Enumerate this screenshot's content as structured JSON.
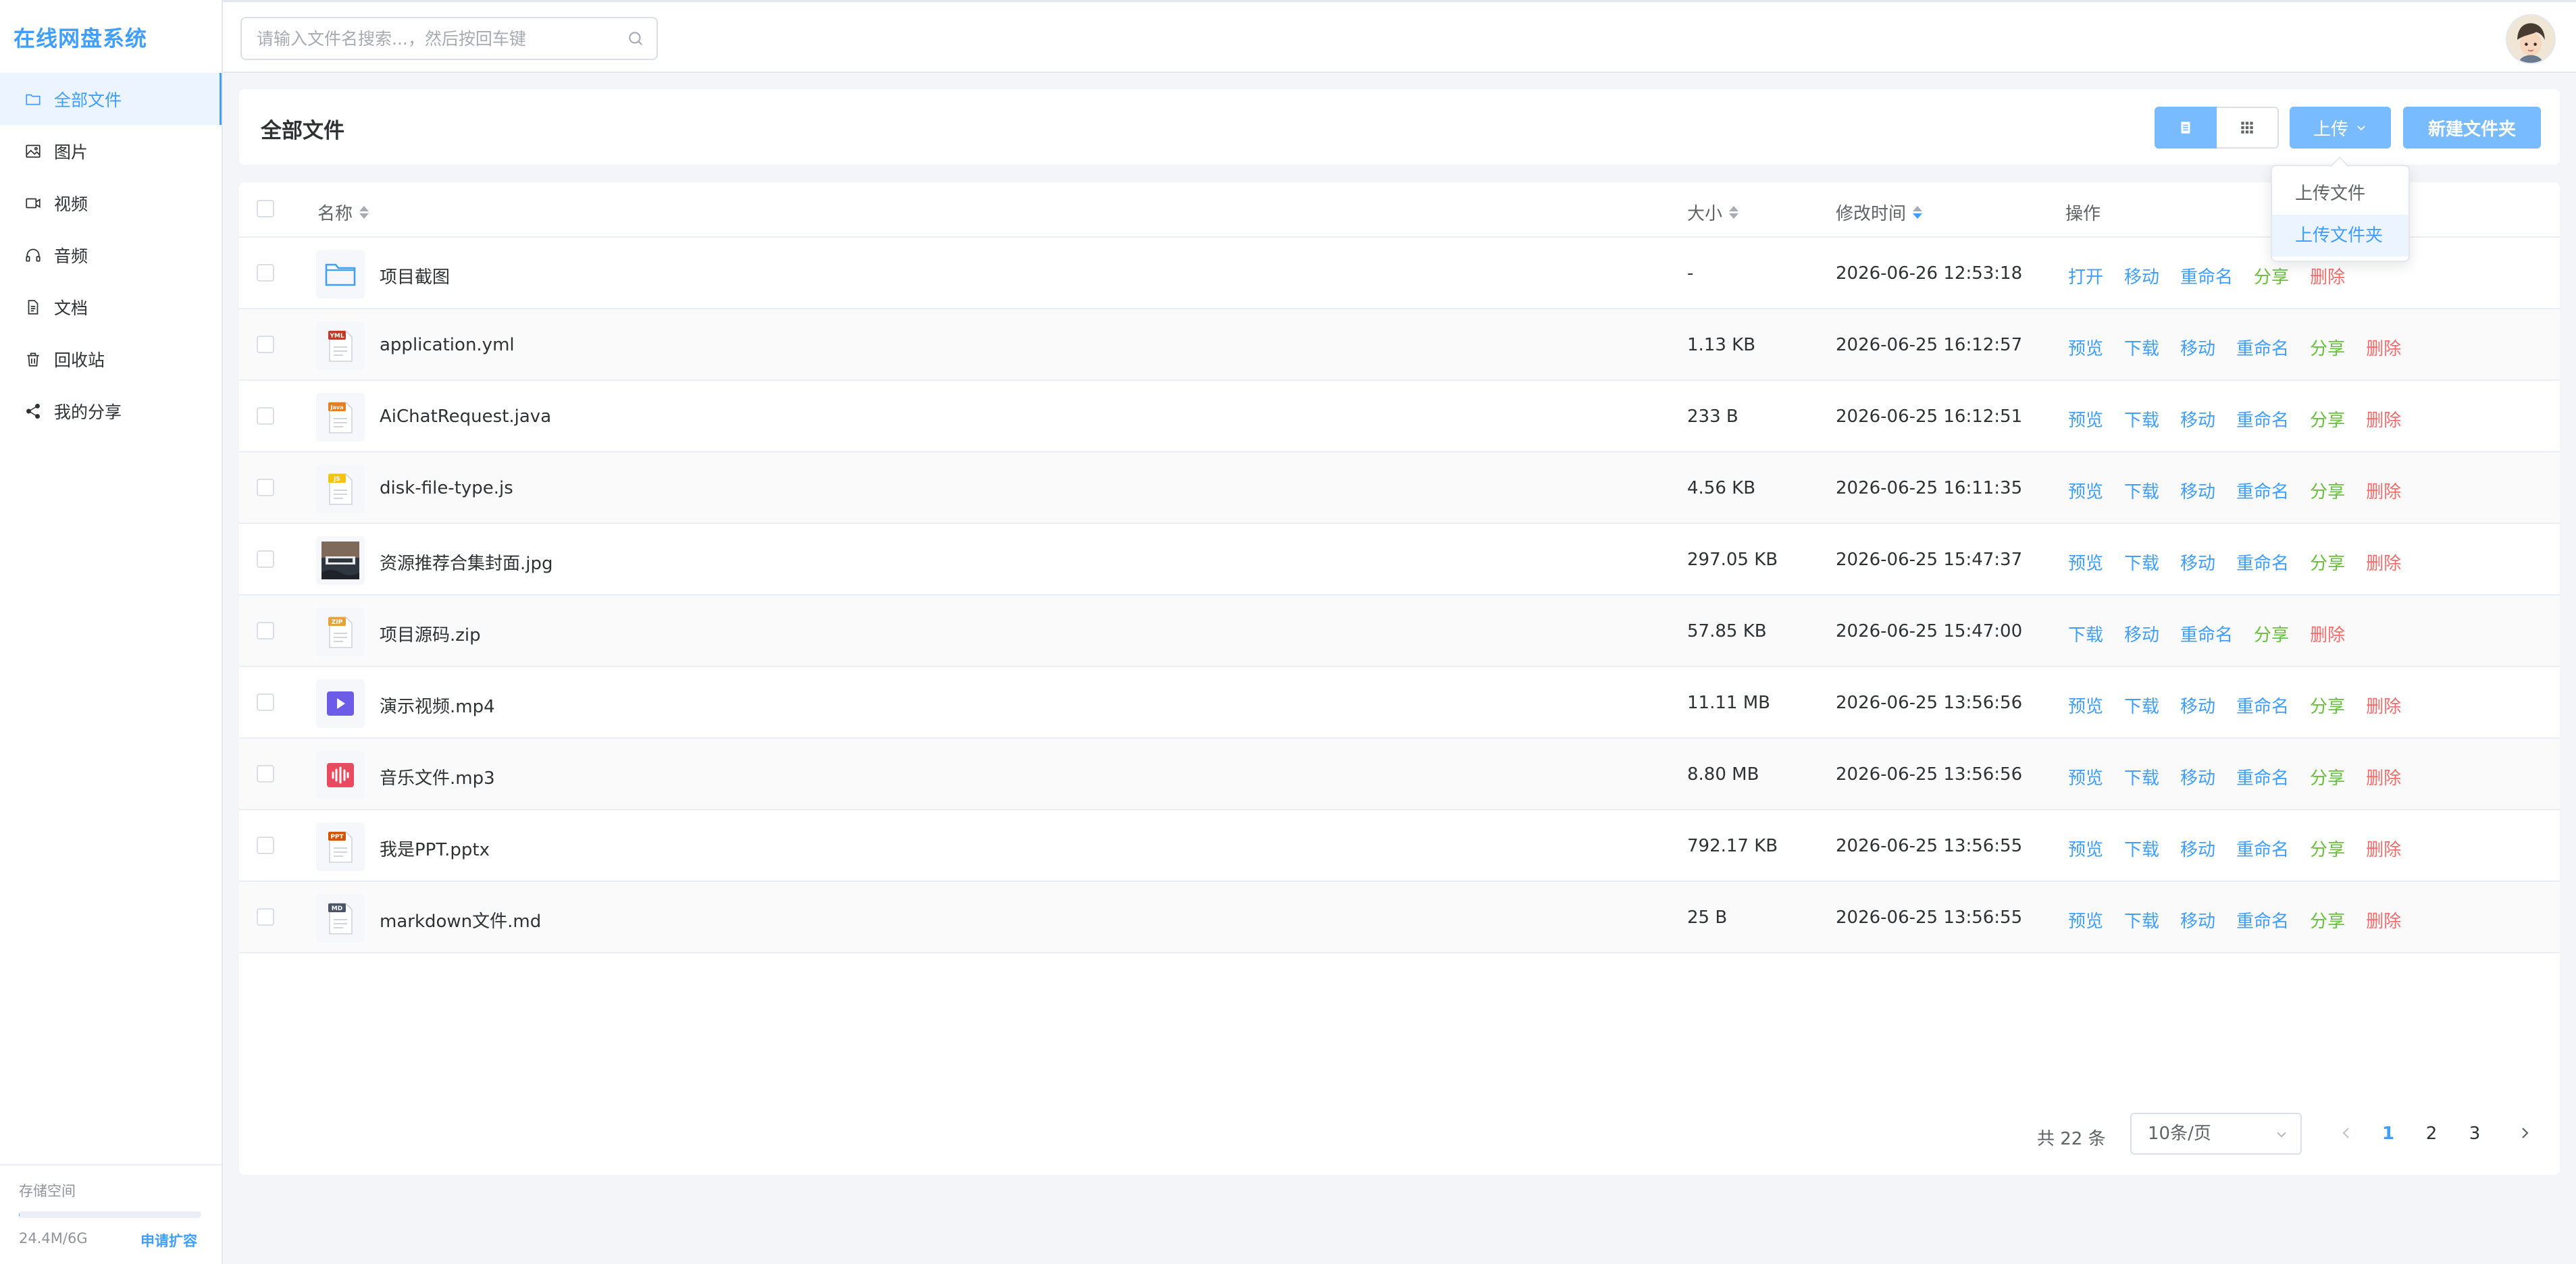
{
  "app": {
    "title": "在线网盘系统"
  },
  "sidebar": {
    "items": [
      {
        "label": "全部文件",
        "icon": "folder-icon",
        "active": true
      },
      {
        "label": "图片",
        "icon": "image-icon"
      },
      {
        "label": "视频",
        "icon": "video-icon"
      },
      {
        "label": "音频",
        "icon": "headphones-icon"
      },
      {
        "label": "文档",
        "icon": "document-icon"
      },
      {
        "label": "回收站",
        "icon": "trash-icon"
      },
      {
        "label": "我的分享",
        "icon": "share-icon"
      }
    ],
    "storage": {
      "title": "存储空间",
      "used_text": "24.4M/6G",
      "used_fraction": 0.004,
      "expand_label": "申请扩容"
    }
  },
  "search": {
    "placeholder": "请输入文件名搜索...，然后按回车键"
  },
  "main": {
    "title": "全部文件",
    "upload_label": "上传",
    "new_folder_label": "新建文件夹",
    "upload_menu": [
      "上传文件",
      "上传文件夹"
    ]
  },
  "table": {
    "columns": {
      "name": "名称",
      "size": "大小",
      "time": "修改时间",
      "ops": "操作"
    },
    "rows": [
      {
        "name": "项目截图",
        "size": "-",
        "time": "2026-06-26 12:53:18",
        "type": "folder",
        "ops": [
          "打开",
          "移动",
          "重命名",
          "分享",
          "删除"
        ]
      },
      {
        "name": "application.yml",
        "size": "1.13 KB",
        "time": "2026-06-25 16:12:57",
        "type": "yml",
        "badge": "YML",
        "color": "#c0392b",
        "ops": [
          "预览",
          "下载",
          "移动",
          "重命名",
          "分享",
          "删除"
        ]
      },
      {
        "name": "AiChatRequest.java",
        "size": "233 B",
        "time": "2026-06-25 16:12:51",
        "type": "java",
        "badge": "Java",
        "color": "#e67e22",
        "ops": [
          "预览",
          "下载",
          "移动",
          "重命名",
          "分享",
          "删除"
        ]
      },
      {
        "name": "disk-file-type.js",
        "size": "4.56 KB",
        "time": "2026-06-25 16:11:35",
        "type": "js",
        "badge": "JS",
        "color": "#f1c40f",
        "ops": [
          "预览",
          "下载",
          "移动",
          "重命名",
          "分享",
          "删除"
        ]
      },
      {
        "name": "资源推荐合集封面.jpg",
        "size": "297.05 KB",
        "time": "2026-06-25 15:47:37",
        "type": "image",
        "ops": [
          "预览",
          "下载",
          "移动",
          "重命名",
          "分享",
          "删除"
        ]
      },
      {
        "name": "项目源码.zip",
        "size": "57.85 KB",
        "time": "2026-06-25 15:47:00",
        "type": "zip",
        "badge": "ZIP",
        "color": "#e6a23c",
        "ops": [
          "下载",
          "移动",
          "重命名",
          "分享",
          "删除"
        ]
      },
      {
        "name": "演示视频.mp4",
        "size": "11.11 MB",
        "time": "2026-06-25 13:56:56",
        "type": "video",
        "color": "#6c5ce7",
        "ops": [
          "预览",
          "下载",
          "移动",
          "重命名",
          "分享",
          "删除"
        ]
      },
      {
        "name": "音乐文件.mp3",
        "size": "8.80 MB",
        "time": "2026-06-25 13:56:56",
        "type": "audio",
        "color": "#e84a5f",
        "ops": [
          "预览",
          "下载",
          "移动",
          "重命名",
          "分享",
          "删除"
        ]
      },
      {
        "name": "我是PPT.pptx",
        "size": "792.17 KB",
        "time": "2026-06-25 13:56:55",
        "type": "ppt",
        "badge": "PPT",
        "color": "#d35400",
        "ops": [
          "预览",
          "下载",
          "移动",
          "重命名",
          "分享",
          "删除"
        ]
      },
      {
        "name": "markdown文件.md",
        "size": "25 B",
        "time": "2026-06-25 13:56:55",
        "type": "md",
        "badge": "MD",
        "color": "#4a5568",
        "ops": [
          "预览",
          "下载",
          "移动",
          "重命名",
          "分享",
          "删除"
        ]
      }
    ]
  },
  "pagination": {
    "total_text": "共 22 条",
    "page_size": "10条/页",
    "pages": [
      "1",
      "2",
      "3"
    ],
    "current": "1"
  },
  "colors": {
    "accent": "#409eff",
    "green": "#67c23a",
    "red": "#f56c6c"
  }
}
